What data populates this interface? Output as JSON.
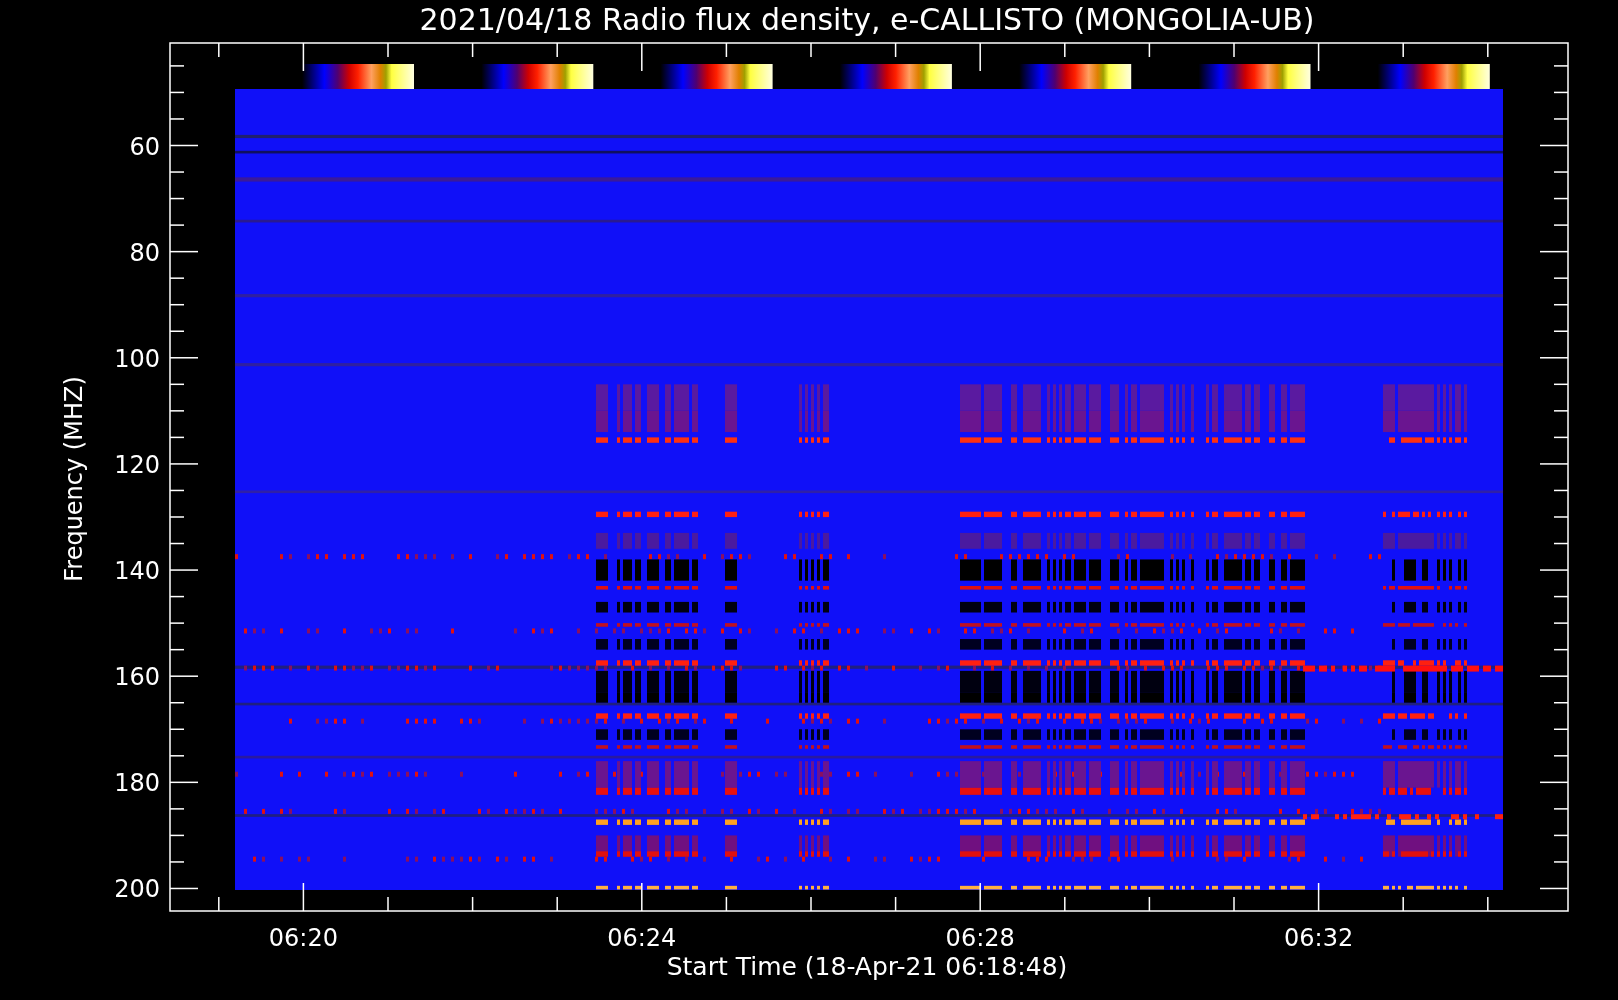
{
  "title": "2021/04/18  Radio flux density, e-CALLISTO (MONGOLIA-UB)",
  "ylabel": "Frequency (MHZ)",
  "xlabel": "Start Time (18-Apr-21 06:18:48)",
  "yticks": [
    "60",
    "80",
    "100",
    "120",
    "140",
    "160",
    "180",
    "200"
  ],
  "xticks": [
    "06:20",
    "06:24",
    "06:28",
    "06:32"
  ]
}
